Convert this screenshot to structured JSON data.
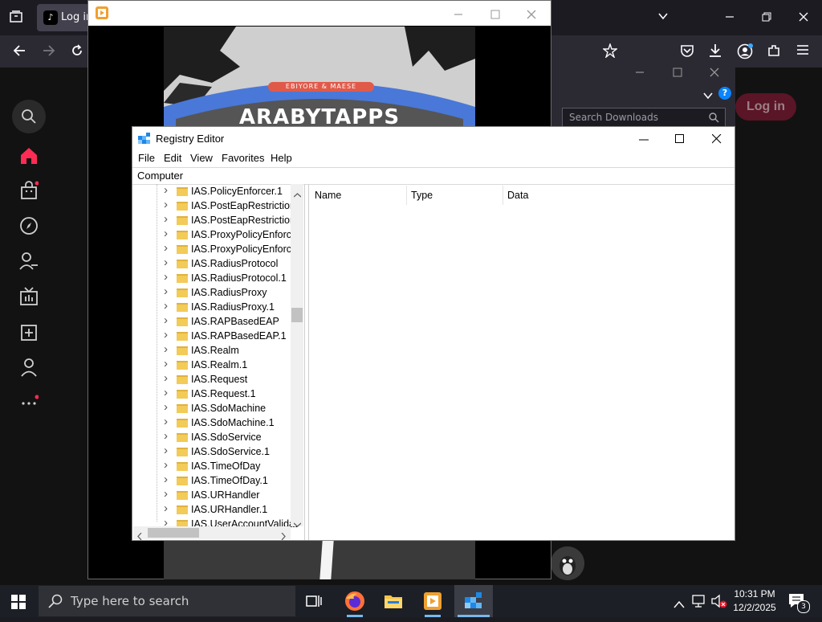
{
  "browser": {
    "tab_title": "Log in",
    "tab_favicon": "tiktok-logo",
    "sidebar_icons": [
      "search-icon",
      "home-icon",
      "shop-icon",
      "explore-icon",
      "following-icon",
      "live-icon",
      "upload-icon",
      "profile-icon",
      "more-icon"
    ],
    "downloads_search_placeholder": "Search Downloads",
    "login_label": "Log in",
    "help_icon": "?"
  },
  "media_player": {
    "video_text_top": "EBIYORE & MAESE",
    "video_text_main": "ARABYTAPPS"
  },
  "registry": {
    "title": "Registry Editor",
    "menu": [
      "File",
      "Edit",
      "View",
      "Favorites",
      "Help"
    ],
    "address": "Computer",
    "tree_items": [
      "IAS.PolicyEnforcer.1",
      "IAS.PostEapRestrictions",
      "IAS.PostEapRestrictions",
      "IAS.ProxyPolicyEnforce",
      "IAS.ProxyPolicyEnforce",
      "IAS.RadiusProtocol",
      "IAS.RadiusProtocol.1",
      "IAS.RadiusProxy",
      "IAS.RadiusProxy.1",
      "IAS.RAPBasedEAP",
      "IAS.RAPBasedEAP.1",
      "IAS.Realm",
      "IAS.Realm.1",
      "IAS.Request",
      "IAS.Request.1",
      "IAS.SdoMachine",
      "IAS.SdoMachine.1",
      "IAS.SdoService",
      "IAS.SdoService.1",
      "IAS.TimeOfDay",
      "IAS.TimeOfDay.1",
      "IAS.URHandler",
      "IAS.URHandler.1",
      "IAS.UserAccountValidat"
    ],
    "columns": [
      "Name",
      "Type",
      "Data"
    ]
  },
  "taskbar": {
    "search_placeholder": "Type here to search",
    "time": "10:31 PM",
    "date": "12/2/2025",
    "notification_count": "3"
  },
  "colors": {
    "accent_red": "#fe2c55",
    "taskbar_bg": "#1d1f26",
    "firefox_dark": "#1c1b22"
  }
}
